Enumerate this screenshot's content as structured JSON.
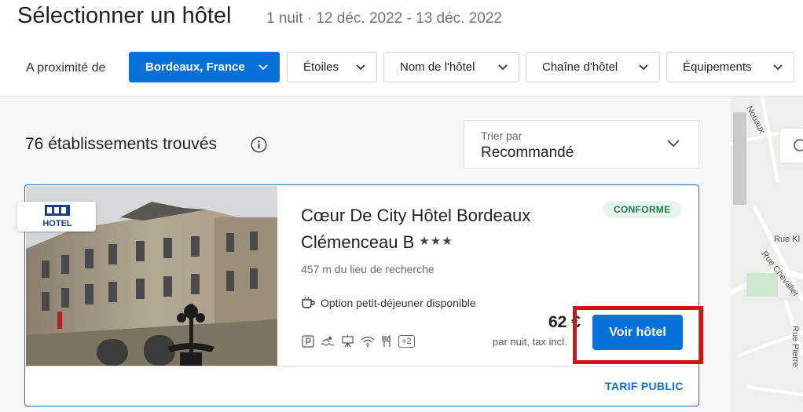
{
  "header": {
    "title": "Sélectionner un hôtel",
    "subtitle": "1 nuit · 12 déc. 2022 - 13 déc. 2022"
  },
  "filters": {
    "label": "A proximité de",
    "location": "Bordeaux, France",
    "stars": "Étoiles",
    "hotel_name": "Nom de l'hôtel",
    "chain": "Chaîne d'hôtel",
    "amenities": "Équipements"
  },
  "results": {
    "count_text": "76 établissements trouvés",
    "sort_label": "Trier par",
    "sort_value": "Recommandé"
  },
  "hotel": {
    "name": "Cœur De City Hôtel Bordeaux Clémenceau B",
    "stars": "★★★",
    "logo_text": "HOTEL",
    "distance": "457 m du lieu de recherche",
    "badge": "CONFORME",
    "breakfast": "Option petit-déjeuner disponible",
    "more_amenities": "+2",
    "price": "62 €",
    "price_sub": "par nuit, tax incl.",
    "cta": "Voir hôtel",
    "rate_type": "TARIF PUBLIC",
    "amenity_icons": [
      "parking-icon",
      "pool-icon",
      "meeting-room-icon",
      "wifi-icon",
      "restaurant-icon"
    ]
  },
  "map": {
    "streets": [
      "Nouaux",
      "Rue Kl",
      "Rue Chevalier",
      "Rue Pierre"
    ]
  },
  "colors": {
    "primary": "#0770d9",
    "highlight": "#d21414",
    "badge_bg": "#e7f6ec",
    "badge_text": "#1f7a4d"
  }
}
